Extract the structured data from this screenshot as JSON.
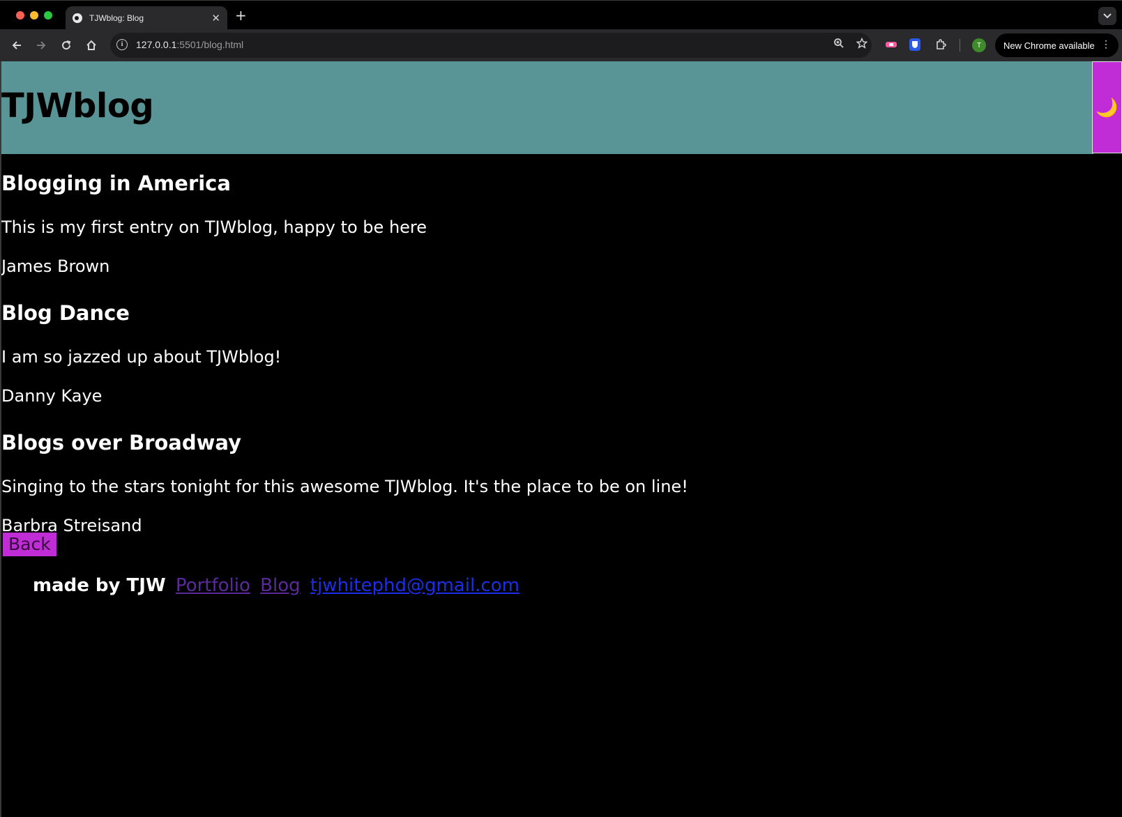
{
  "browser": {
    "tab_title": "TJWblog: Blog",
    "tab_close": "✕",
    "new_tab": "+",
    "url_host": "127.0.0.1",
    "url_rest": ":5501/blog.html",
    "avatar_letter": "T",
    "update_label": "New Chrome available"
  },
  "site": {
    "title": "TJWblog",
    "theme_toggle_icon": "🌙"
  },
  "posts": [
    {
      "title": "Blogging in America",
      "body": "This is my first entry on TJWblog, happy to be here",
      "author": "James Brown"
    },
    {
      "title": "Blog Dance",
      "body": "I am so jazzed up about TJWblog!",
      "author": "Danny Kaye"
    },
    {
      "title": "Blogs over Broadway",
      "body": "Singing to the stars tonight for this awesome TJWblog. It's the place to be on line!",
      "author": "Barbra Streisand"
    }
  ],
  "back_label": "Back",
  "footer": {
    "made_by": "made by TJW",
    "portfolio": "Portfolio",
    "blog": "Blog",
    "email": "tjwhitephd@gmail.com"
  },
  "colors": {
    "header_bg": "#599596",
    "accent": "#c02dd6",
    "page_bg": "#000000",
    "visited_link": "#5b2a9a",
    "link": "#1b2ee8"
  }
}
